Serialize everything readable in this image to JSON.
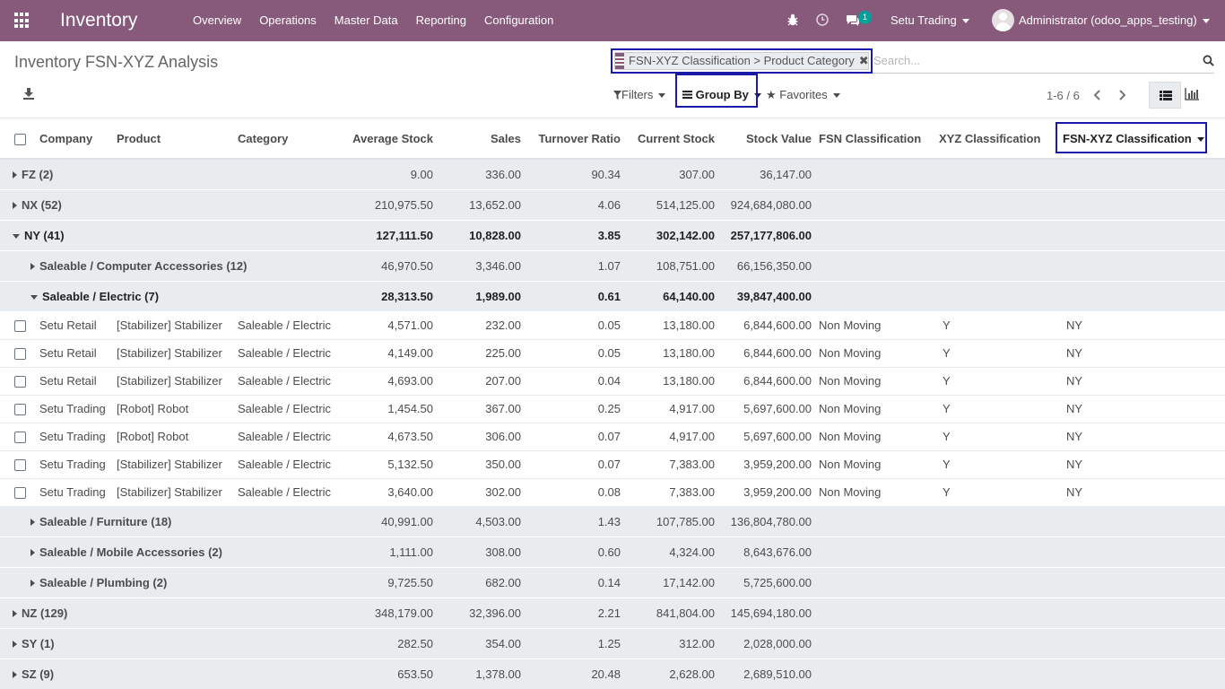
{
  "nav": {
    "brand": "Inventory",
    "menu": [
      "Overview",
      "Operations",
      "Master Data",
      "Reporting",
      "Configuration"
    ],
    "company": "Setu Trading",
    "user": "Administrator (odoo_apps_testing)",
    "message_count": "1",
    "accent_color": "#875a7b"
  },
  "page": {
    "title": "Inventory FSN-XYZ Analysis"
  },
  "search": {
    "facet": "FSN-XYZ Classification > Product Category",
    "placeholder": "Search..."
  },
  "toolbar": {
    "filters": "Filters",
    "group_by": "Group By",
    "favorites": "Favorites",
    "pager": "1-6 / 6"
  },
  "columns": [
    "Company",
    "Product",
    "Category",
    "Average Stock",
    "Sales",
    "Turnover Ratio",
    "Current Stock",
    "Stock Value",
    "FSN Classification",
    "XYZ Classification",
    "FSN-XYZ Classification"
  ],
  "groups": [
    {
      "label": "FZ (2)",
      "avg": "9.00",
      "sales": "336.00",
      "turn": "90.34",
      "cur": "307.00",
      "value": "36,147.00"
    },
    {
      "label": "NX (52)",
      "avg": "210,975.50",
      "sales": "13,652.00",
      "turn": "4.06",
      "cur": "514,125.00",
      "value": "924,684,080.00"
    },
    {
      "label": "NY (41)",
      "avg": "127,111.50",
      "sales": "10,828.00",
      "turn": "3.85",
      "cur": "302,142.00",
      "value": "257,177,806.00"
    },
    {
      "label": "Saleable / Computer Accessories (12)",
      "avg": "46,970.50",
      "sales": "3,346.00",
      "turn": "1.07",
      "cur": "108,751.00",
      "value": "66,156,350.00"
    },
    {
      "label": "Saleable / Electric (7)",
      "avg": "28,313.50",
      "sales": "1,989.00",
      "turn": "0.61",
      "cur": "64,140.00",
      "value": "39,847,400.00"
    },
    {
      "label": "Saleable / Furniture (18)",
      "avg": "40,991.00",
      "sales": "4,503.00",
      "turn": "1.43",
      "cur": "107,785.00",
      "value": "136,804,780.00"
    },
    {
      "label": "Saleable / Mobile Accessories (2)",
      "avg": "1,111.00",
      "sales": "308.00",
      "turn": "0.60",
      "cur": "4,324.00",
      "value": "8,643,676.00"
    },
    {
      "label": "Saleable / Plumbing (2)",
      "avg": "9,725.50",
      "sales": "682.00",
      "turn": "0.14",
      "cur": "17,142.00",
      "value": "5,725,600.00"
    },
    {
      "label": "NZ (129)",
      "avg": "348,179.00",
      "sales": "32,396.00",
      "turn": "2.21",
      "cur": "841,804.00",
      "value": "145,694,180.00"
    },
    {
      "label": "SY (1)",
      "avg": "282.50",
      "sales": "354.00",
      "turn": "1.25",
      "cur": "312.00",
      "value": "2,028,000.00"
    },
    {
      "label": "SZ (9)",
      "avg": "653.50",
      "sales": "1,378.00",
      "turn": "20.48",
      "cur": "2,628.00",
      "value": "2,689,510.00"
    }
  ],
  "rows": [
    {
      "company": "Setu Retail",
      "product": "[Stabilizer] Stabilizer",
      "category": "Saleable / Electric",
      "avg": "4,571.00",
      "sales": "232.00",
      "turn": "0.05",
      "cur": "13,180.00",
      "value": "6,844,600.00",
      "fsn": "Non Moving",
      "xyz": "Y",
      "fsnxyz": "NY"
    },
    {
      "company": "Setu Retail",
      "product": "[Stabilizer] Stabilizer",
      "category": "Saleable / Electric",
      "avg": "4,149.00",
      "sales": "225.00",
      "turn": "0.05",
      "cur": "13,180.00",
      "value": "6,844,600.00",
      "fsn": "Non Moving",
      "xyz": "Y",
      "fsnxyz": "NY"
    },
    {
      "company": "Setu Retail",
      "product": "[Stabilizer] Stabilizer",
      "category": "Saleable / Electric",
      "avg": "4,693.00",
      "sales": "207.00",
      "turn": "0.04",
      "cur": "13,180.00",
      "value": "6,844,600.00",
      "fsn": "Non Moving",
      "xyz": "Y",
      "fsnxyz": "NY"
    },
    {
      "company": "Setu Trading",
      "product": "[Robot] Robot",
      "category": "Saleable / Electric",
      "avg": "1,454.50",
      "sales": "367.00",
      "turn": "0.25",
      "cur": "4,917.00",
      "value": "5,697,600.00",
      "fsn": "Non Moving",
      "xyz": "Y",
      "fsnxyz": "NY"
    },
    {
      "company": "Setu Trading",
      "product": "[Robot] Robot",
      "category": "Saleable / Electric",
      "avg": "4,673.50",
      "sales": "306.00",
      "turn": "0.07",
      "cur": "4,917.00",
      "value": "5,697,600.00",
      "fsn": "Non Moving",
      "xyz": "Y",
      "fsnxyz": "NY"
    },
    {
      "company": "Setu Trading",
      "product": "[Stabilizer] Stabilizer",
      "category": "Saleable / Electric",
      "avg": "5,132.50",
      "sales": "350.00",
      "turn": "0.07",
      "cur": "7,383.00",
      "value": "3,959,200.00",
      "fsn": "Non Moving",
      "xyz": "Y",
      "fsnxyz": "NY"
    },
    {
      "company": "Setu Trading",
      "product": "[Stabilizer] Stabilizer",
      "category": "Saleable / Electric",
      "avg": "3,640.00",
      "sales": "302.00",
      "turn": "0.08",
      "cur": "7,383.00",
      "value": "3,959,200.00",
      "fsn": "Non Moving",
      "xyz": "Y",
      "fsnxyz": "NY"
    }
  ]
}
